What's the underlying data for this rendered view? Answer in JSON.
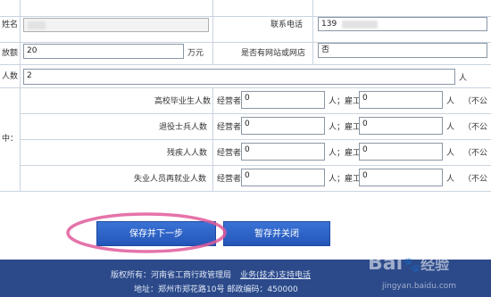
{
  "form": {
    "name_label": "姓名",
    "phone_label": "联系电话",
    "phone_value": "139",
    "amount_label": "放额",
    "amount_value": "20",
    "amount_unit": "万元",
    "website_label": "是否有网站或网店",
    "website_value": "否",
    "people_label": "人数",
    "people_value": "2",
    "people_unit": "人",
    "section_label": "中：",
    "rows": [
      {
        "label": "高校毕业生人数",
        "operator_label": "经营者",
        "operator_value": "0",
        "unit1": "人；雇工",
        "employee_value": "0",
        "unit2": "人",
        "note": "（不公"
      },
      {
        "label": "退役士兵人数",
        "operator_label": "经营者",
        "operator_value": "0",
        "unit1": "人；雇工",
        "employee_value": "0",
        "unit2": "人",
        "note": "（不公"
      },
      {
        "label": "残疾人人数",
        "operator_label": "经营者",
        "operator_value": "0",
        "unit1": "人；雇工",
        "employee_value": "0",
        "unit2": "人",
        "note": "（不公"
      },
      {
        "label": "失业人员再就业人数",
        "operator_label": "经营者",
        "operator_value": "0",
        "unit1": "人；雇工",
        "employee_value": "0",
        "unit2": "人",
        "note": "（不公"
      }
    ]
  },
  "buttons": {
    "save_next": "保存并下一步",
    "save_close": "暂存并关闭"
  },
  "footer": {
    "copyright_prefix": "版权所有：河南省工商行政管理局",
    "support": "业务(技术)支持电话",
    "address": "地址：郑州市郑花路10号   邮政编码：450000"
  },
  "watermark": {
    "brand": "Bai",
    "brand_cn": "经验",
    "url": "jingyan.baidu.com"
  },
  "colors": {
    "button_blue": "#2d63c8",
    "footer_blue": "#2c4a8a",
    "highlight_ellipse": "#e05a9a"
  }
}
